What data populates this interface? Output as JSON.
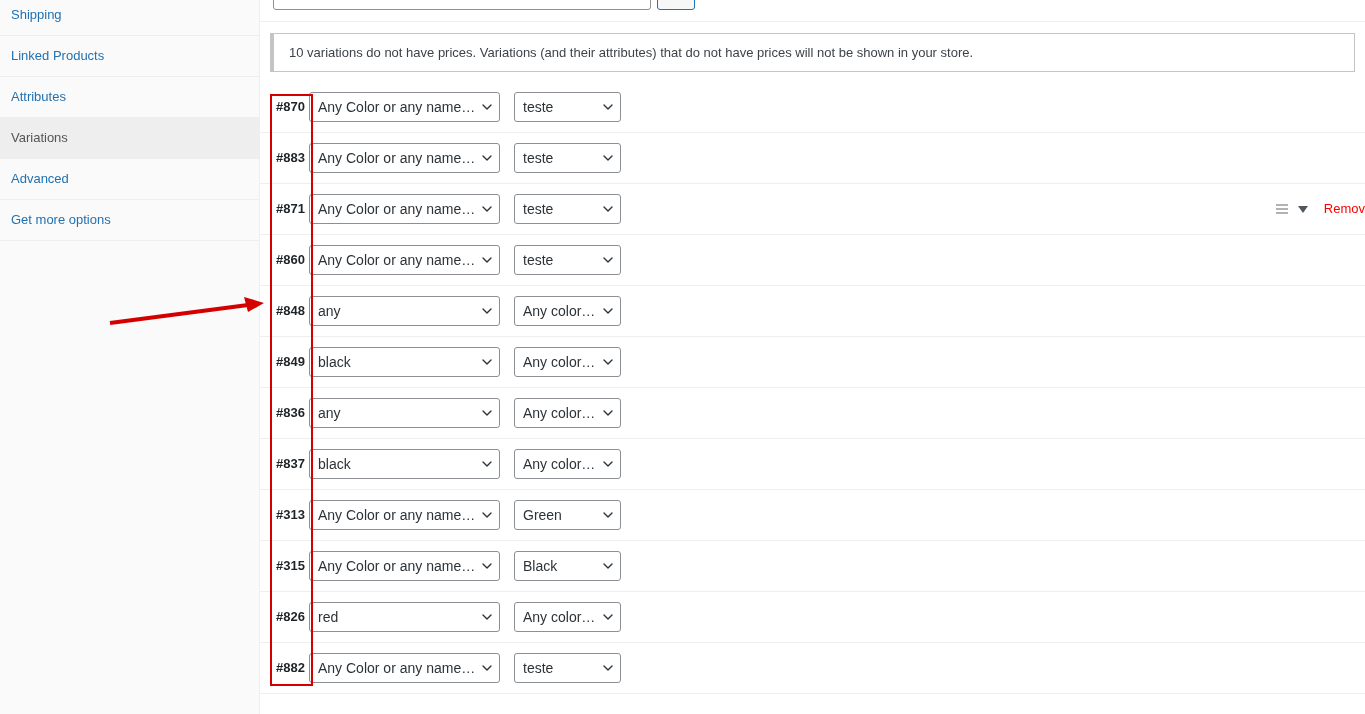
{
  "sidebar": {
    "items": [
      {
        "label": "Shipping",
        "selected": false
      },
      {
        "label": "Linked Products",
        "selected": false
      },
      {
        "label": "Attributes",
        "selected": false
      },
      {
        "label": "Variations",
        "selected": true
      },
      {
        "label": "Advanced",
        "selected": false
      },
      {
        "label": "Get more options",
        "selected": false
      }
    ]
  },
  "notice": "10 variations do not have prices. Variations (and their attributes) that do not have prices will not be shown in your store.",
  "variations": [
    {
      "id": "#870",
      "attribute_1": "Any Color or any name…",
      "attribute_2": "teste"
    },
    {
      "id": "#883",
      "attribute_1": "Any Color or any name…",
      "attribute_2": "teste"
    },
    {
      "id": "#871",
      "attribute_1": "Any Color or any name…",
      "attribute_2": "teste",
      "remove": "Remov"
    },
    {
      "id": "#860",
      "attribute_1": "Any Color or any name…",
      "attribute_2": "teste"
    },
    {
      "id": "#848",
      "attribute_1": "any",
      "attribute_2": "Any color…"
    },
    {
      "id": "#849",
      "attribute_1": "black",
      "attribute_2": "Any color…"
    },
    {
      "id": "#836",
      "attribute_1": "any",
      "attribute_2": "Any color…"
    },
    {
      "id": "#837",
      "attribute_1": "black",
      "attribute_2": "Any color…"
    },
    {
      "id": "#313",
      "attribute_1": "Any Color or any name…",
      "attribute_2": "Green"
    },
    {
      "id": "#315",
      "attribute_1": "Any Color or any name…",
      "attribute_2": "Black"
    },
    {
      "id": "#826",
      "attribute_1": "red",
      "attribute_2": "Any color…"
    },
    {
      "id": "#882",
      "attribute_1": "Any Color or any name…",
      "attribute_2": "teste"
    }
  ]
}
